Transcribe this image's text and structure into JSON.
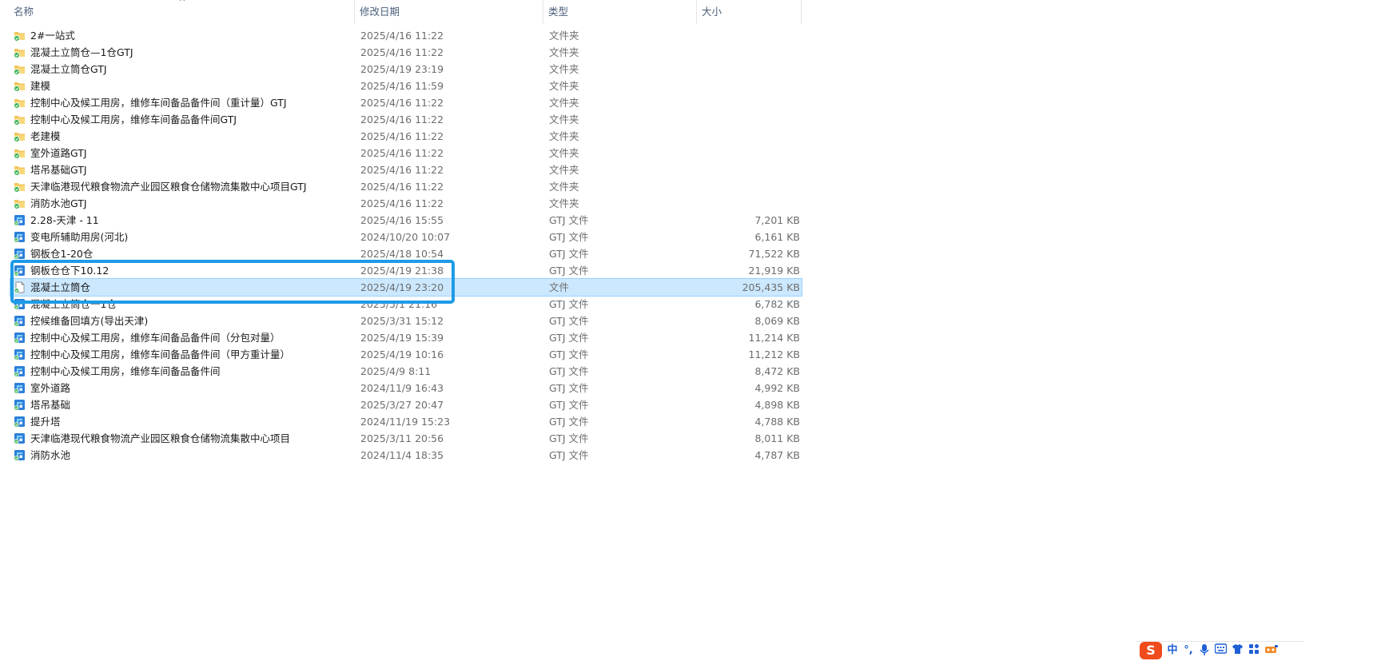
{
  "columns": {
    "name": "名称",
    "date": "修改日期",
    "type": "类型",
    "size": "大小"
  },
  "sort_indicator": "^",
  "files": [
    {
      "name": "2#一站式",
      "date": "2025/4/16 11:22",
      "type": "文件夹",
      "size": "",
      "icon": "folder-sync-icon"
    },
    {
      "name": "混凝土立筒仓—1仓GTJ",
      "date": "2025/4/16 11:22",
      "type": "文件夹",
      "size": "",
      "icon": "folder-sync-icon"
    },
    {
      "name": "混凝土立筒仓GTJ",
      "date": "2025/4/19 23:19",
      "type": "文件夹",
      "size": "",
      "icon": "folder-sync-icon"
    },
    {
      "name": "建模",
      "date": "2025/4/16 11:59",
      "type": "文件夹",
      "size": "",
      "icon": "folder-sync-icon"
    },
    {
      "name": "控制中心及候工用房，维修车间备品备件间（重计量）GTJ",
      "date": "2025/4/16 11:22",
      "type": "文件夹",
      "size": "",
      "icon": "folder-sync-icon"
    },
    {
      "name": "控制中心及候工用房，维修车间备品备件间GTJ",
      "date": "2025/4/16 11:22",
      "type": "文件夹",
      "size": "",
      "icon": "folder-sync-icon"
    },
    {
      "name": "老建模",
      "date": "2025/4/16 11:22",
      "type": "文件夹",
      "size": "",
      "icon": "folder-sync-icon"
    },
    {
      "name": "室外道路GTJ",
      "date": "2025/4/16 11:22",
      "type": "文件夹",
      "size": "",
      "icon": "folder-sync-icon"
    },
    {
      "name": "塔吊基础GTJ",
      "date": "2025/4/16 11:22",
      "type": "文件夹",
      "size": "",
      "icon": "folder-sync-icon"
    },
    {
      "name": "天津临港现代粮食物流产业园区粮食仓储物流集散中心项目GTJ",
      "date": "2025/4/16 11:22",
      "type": "文件夹",
      "size": "",
      "icon": "folder-sync-icon"
    },
    {
      "name": "消防水池GTJ",
      "date": "2025/4/16 11:22",
      "type": "文件夹",
      "size": "",
      "icon": "folder-sync-icon"
    },
    {
      "name": "2.28-天津 - 11",
      "date": "2025/4/16 15:55",
      "type": "GTJ 文件",
      "size": "7,201 KB",
      "icon": "gtj-file-icon"
    },
    {
      "name": "变电所辅助用房(河北)",
      "date": "2024/10/20 10:07",
      "type": "GTJ 文件",
      "size": "6,161 KB",
      "icon": "gtj-file-icon"
    },
    {
      "name": "钢板仓1-20仓",
      "date": "2025/4/18 10:54",
      "type": "GTJ 文件",
      "size": "71,522 KB",
      "icon": "gtj-file-icon"
    },
    {
      "name": "钢板仓仓下10.12",
      "date": "2025/4/19 21:38",
      "type": "GTJ 文件",
      "size": "21,919 KB",
      "icon": "gtj-file-icon"
    },
    {
      "name": "混凝土立筒仓",
      "date": "2025/4/19 23:20",
      "type": "文件",
      "size": "205,435 KB",
      "icon": "blank-file-icon",
      "selected": true
    },
    {
      "name": "混凝土立筒仓一1仓",
      "date": "2025/5/1 21:16",
      "type": "GTJ 文件",
      "size": "6,782 KB",
      "icon": "gtj-file-icon"
    },
    {
      "name": "控候维备回填方(导出天津)",
      "date": "2025/3/31 15:12",
      "type": "GTJ 文件",
      "size": "8,069 KB",
      "icon": "gtj-file-icon"
    },
    {
      "name": "控制中心及候工用房，维修车间备品备件间（分包对量）",
      "date": "2025/4/19 15:39",
      "type": "GTJ 文件",
      "size": "11,214 KB",
      "icon": "gtj-file-icon"
    },
    {
      "name": "控制中心及候工用房，维修车间备品备件间（甲方重计量）",
      "date": "2025/4/19 10:16",
      "type": "GTJ 文件",
      "size": "11,212 KB",
      "icon": "gtj-file-icon"
    },
    {
      "name": "控制中心及候工用房，维修车间备品备件间",
      "date": "2025/4/9 8:11",
      "type": "GTJ 文件",
      "size": "8,472 KB",
      "icon": "gtj-file-icon"
    },
    {
      "name": "室外道路",
      "date": "2024/11/9 16:43",
      "type": "GTJ 文件",
      "size": "4,992 KB",
      "icon": "gtj-file-icon"
    },
    {
      "name": "塔吊基础",
      "date": "2025/3/27 20:47",
      "type": "GTJ 文件",
      "size": "4,898 KB",
      "icon": "gtj-file-icon"
    },
    {
      "name": "提升塔",
      "date": "2024/11/19 15:23",
      "type": "GTJ 文件",
      "size": "4,788 KB",
      "icon": "gtj-file-icon"
    },
    {
      "name": "天津临港现代粮食物流产业园区粮食仓储物流集散中心项目",
      "date": "2025/3/11 20:56",
      "type": "GTJ 文件",
      "size": "8,011 KB",
      "icon": "gtj-file-icon"
    },
    {
      "name": "消防水池",
      "date": "2024/11/4 18:35",
      "type": "GTJ 文件",
      "size": "4,787 KB",
      "icon": "gtj-file-icon"
    }
  ],
  "ime": {
    "logo": "S",
    "mode": "中",
    "punct": "°,",
    "icons": [
      "microphone-icon",
      "keyboard-icon",
      "shirt-icon",
      "grid-icon",
      "toolbox-icon"
    ]
  },
  "colors": {
    "selection": "#cce8ff",
    "highlight_border": "#1e9be8",
    "folder": "#f2c55c",
    "sync_check": "#2fae4b",
    "gtj_blue": "#2e7fd8"
  }
}
